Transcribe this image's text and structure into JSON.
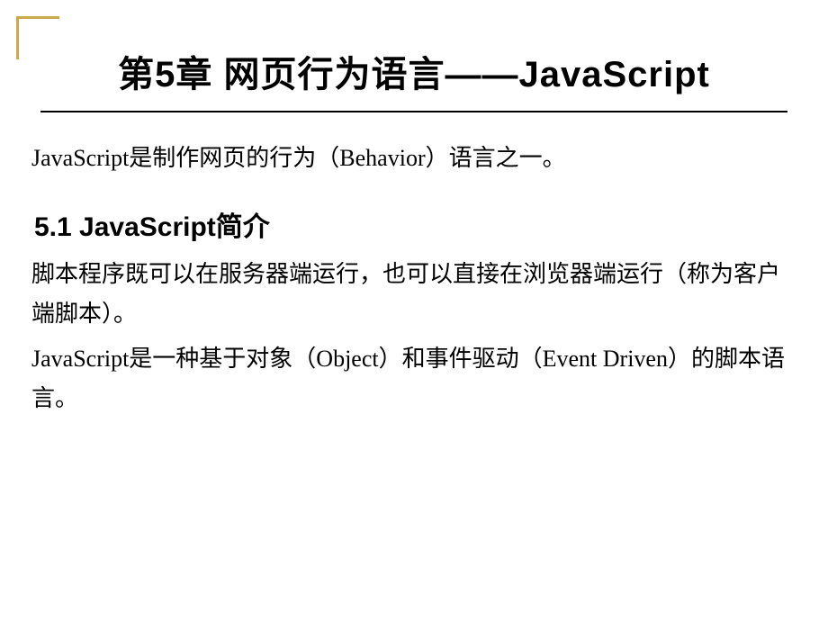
{
  "document": {
    "title": "第5章  网页行为语言——JavaScript",
    "intro": "JavaScript是制作网页的行为（Behavior）语言之一。",
    "section": {
      "heading": "5.1  JavaScript简介",
      "paragraphs": [
        "脚本程序既可以在服务器端运行，也可以直接在浏览器端运行（称为客户端脚本）。",
        "JavaScript是一种基于对象（Object）和事件驱动（Event Driven）的脚本语言。"
      ]
    }
  }
}
